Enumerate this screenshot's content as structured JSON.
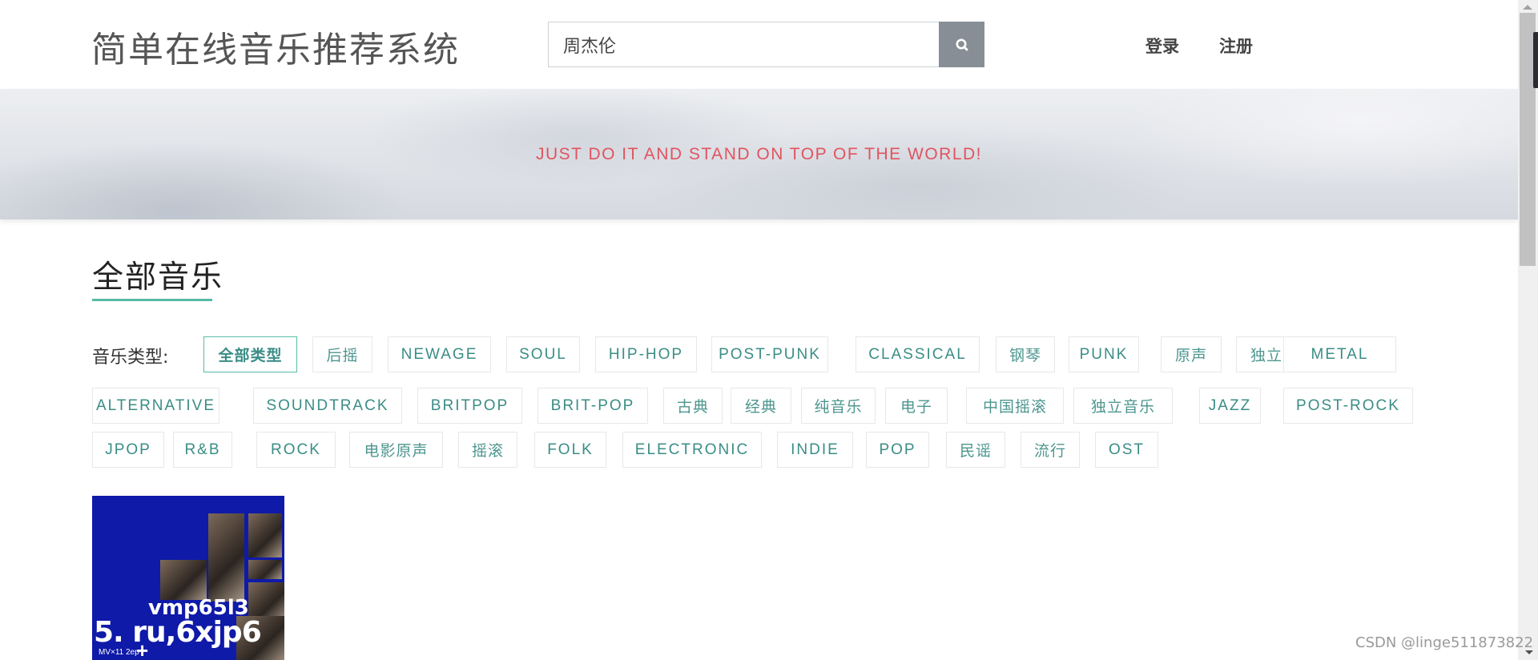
{
  "header": {
    "site_title": "简单在线音乐推荐系统",
    "search": {
      "value": "周杰伦",
      "placeholder": "",
      "button_icon": "search-icon"
    },
    "nav": [
      {
        "label": "登录"
      },
      {
        "label": "注册"
      }
    ]
  },
  "banner": {
    "slogan": "JUST DO IT AND STAND ON TOP OF THE WORLD!"
  },
  "section": {
    "title": "全部音乐",
    "filter_label": "音乐类型:",
    "accent_color": "#55bca5",
    "selected_tag": "全部类型",
    "tags": [
      {
        "label": "全部类型",
        "active": true
      },
      {
        "label": "后摇"
      },
      {
        "label": "NEWAGE"
      },
      {
        "label": "SOUL"
      },
      {
        "label": "HIP-HOP"
      },
      {
        "label": "POST-PUNK"
      },
      {
        "label": "CLASSICAL"
      },
      {
        "label": "钢琴"
      },
      {
        "label": "PUNK"
      },
      {
        "label": "原声"
      },
      {
        "label": "独立"
      },
      {
        "label": "METAL"
      },
      {
        "label": "ALTERNATIVE"
      },
      {
        "label": "SOUNDTRACK"
      },
      {
        "label": "BRITPOP"
      },
      {
        "label": "BRIT-POP"
      },
      {
        "label": "古典"
      },
      {
        "label": "经典"
      },
      {
        "label": "纯音乐"
      },
      {
        "label": "电子"
      },
      {
        "label": "中国摇滚"
      },
      {
        "label": "独立音乐"
      },
      {
        "label": "JAZZ"
      },
      {
        "label": "POST-ROCK"
      },
      {
        "label": "JPOP"
      },
      {
        "label": "R&B"
      },
      {
        "label": "ROCK"
      },
      {
        "label": "电影原声"
      },
      {
        "label": "摇滚"
      },
      {
        "label": "FOLK"
      },
      {
        "label": "ELECTRONIC"
      },
      {
        "label": "INDIE"
      },
      {
        "label": "POP"
      },
      {
        "label": "民谣"
      },
      {
        "label": "流行"
      },
      {
        "label": "OST"
      }
    ]
  },
  "albums": [
    {
      "cover_text_1": "vmp65l3",
      "cover_text_2": "5. ru,6xjp6",
      "cover_text_3": "MV×11  2ep",
      "cover_color": "#0f1aa8"
    }
  ],
  "watermark": "CSDN @linge511873822"
}
